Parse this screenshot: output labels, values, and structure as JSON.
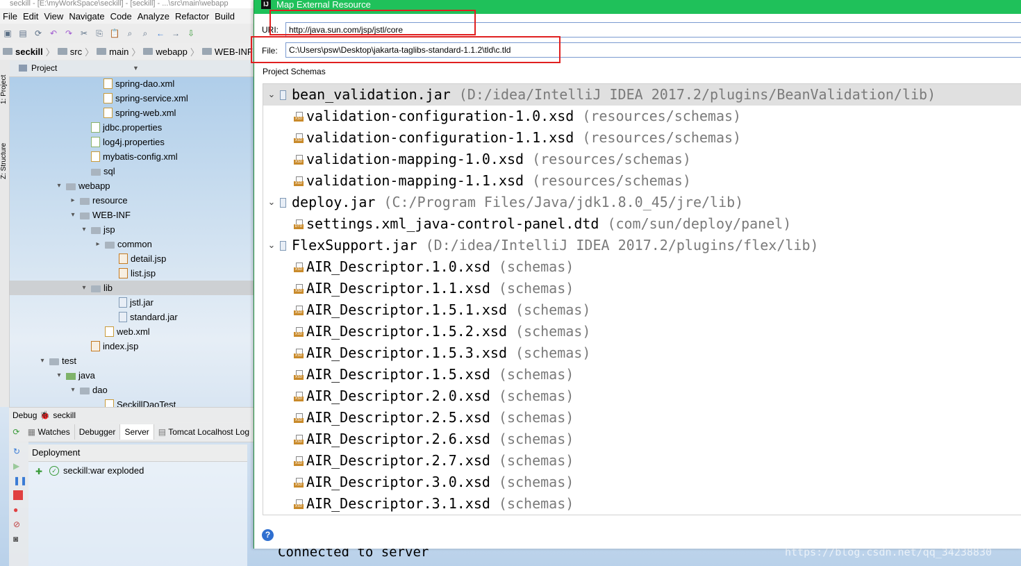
{
  "ide": {
    "titlebar": "seckill - [E:\\myWorkSpace\\seckill] - [seckill] - ...\\src\\main\\webapp",
    "menu": [
      "File",
      "Edit",
      "View",
      "Navigate",
      "Code",
      "Analyze",
      "Refactor",
      "Build"
    ],
    "breadcrumb": [
      "seckill",
      "src",
      "main",
      "webapp",
      "WEB-INF"
    ],
    "left_stripe": [
      "1: Project",
      "Z: Structure"
    ],
    "project_panel_title": "Project",
    "tree": [
      {
        "label": "spring-dao.xml",
        "icon": "xml-file-icon"
      },
      {
        "label": "spring-service.xml",
        "icon": "xml-file-icon"
      },
      {
        "label": "spring-web.xml",
        "icon": "xml-file-icon"
      },
      {
        "label": "jdbc.properties",
        "icon": "properties-file-icon"
      },
      {
        "label": "log4j.properties",
        "icon": "properties-file-icon"
      },
      {
        "label": "mybatis-config.xml",
        "icon": "xml-file-icon"
      },
      {
        "label": "sql",
        "icon": "folder-icon"
      },
      {
        "label": "webapp",
        "icon": "folder-icon",
        "arrow": "▾"
      },
      {
        "label": "resource",
        "icon": "folder-icon",
        "arrow": "▸"
      },
      {
        "label": "WEB-INF",
        "icon": "folder-icon",
        "arrow": "▾"
      },
      {
        "label": "jsp",
        "icon": "folder-icon",
        "arrow": "▾"
      },
      {
        "label": "common",
        "icon": "folder-icon",
        "arrow": "▸"
      },
      {
        "label": "detail.jsp",
        "icon": "jsp-file-icon"
      },
      {
        "label": "list.jsp",
        "icon": "jsp-file-icon"
      },
      {
        "label": "lib",
        "icon": "folder-icon",
        "arrow": "▾"
      },
      {
        "label": "jstl.jar",
        "icon": "jar-file-icon"
      },
      {
        "label": "standard.jar",
        "icon": "jar-file-icon"
      },
      {
        "label": "web.xml",
        "icon": "xml-file-icon"
      },
      {
        "label": "index.jsp",
        "icon": "jsp-file-icon"
      },
      {
        "label": "test",
        "icon": "folder-icon",
        "arrow": "▾"
      },
      {
        "label": "java",
        "icon": "java-folder-icon",
        "arrow": "▾"
      },
      {
        "label": "dao",
        "icon": "folder-icon",
        "arrow": "▾"
      },
      {
        "label": "SeckillDaoTest",
        "icon": "class-icon"
      }
    ],
    "debug_label": "Debug",
    "debug_config": "seckill",
    "debug_tabs": [
      "Watches",
      "Debugger",
      "Server",
      "Tomcat Localhost Log"
    ],
    "debug_active_tab": "Server",
    "deployment_header": "Deployment",
    "deployment_item": "seckill:war exploded",
    "console_text": "Connected to server",
    "watermark": "https://blog.csdn.net/qq_34238830"
  },
  "dialog": {
    "title": "Map External Resource",
    "uri_label": "URI:",
    "uri_value": "http://java.sun.com/jsp/jstl/core",
    "file_label": "File:",
    "file_value": "C:\\Users\\psw\\Desktop\\jakarta-taglibs-standard-1.1.2\\tld\\c.tld",
    "schemas_label": "Project Schemas",
    "help_symbol": "?",
    "schemas": [
      {
        "kind": "jar",
        "name": "bean_validation.jar",
        "path": "(D:/idea/IntelliJ IDEA 2017.2/plugins/BeanValidation/lib)",
        "selected": true
      },
      {
        "kind": "xsd",
        "name": "validation-configuration-1.0.xsd",
        "path": "(resources/schemas)"
      },
      {
        "kind": "xsd",
        "name": "validation-configuration-1.1.xsd",
        "path": "(resources/schemas)"
      },
      {
        "kind": "xsd",
        "name": "validation-mapping-1.0.xsd",
        "path": "(resources/schemas)"
      },
      {
        "kind": "xsd",
        "name": "validation-mapping-1.1.xsd",
        "path": "(resources/schemas)"
      },
      {
        "kind": "jar",
        "name": "deploy.jar",
        "path": "(C:/Program Files/Java/jdk1.8.0_45/jre/lib)"
      },
      {
        "kind": "dtd",
        "name": "settings.xml_java-control-panel.dtd",
        "path": "(com/sun/deploy/panel)"
      },
      {
        "kind": "jar",
        "name": "FlexSupport.jar",
        "path": "(D:/idea/IntelliJ IDEA 2017.2/plugins/flex/lib)"
      },
      {
        "kind": "xsd",
        "name": "AIR_Descriptor.1.0.xsd",
        "path": "(schemas)"
      },
      {
        "kind": "xsd",
        "name": "AIR_Descriptor.1.1.xsd",
        "path": "(schemas)"
      },
      {
        "kind": "xsd",
        "name": "AIR_Descriptor.1.5.1.xsd",
        "path": "(schemas)"
      },
      {
        "kind": "xsd",
        "name": "AIR_Descriptor.1.5.2.xsd",
        "path": "(schemas)"
      },
      {
        "kind": "xsd",
        "name": "AIR_Descriptor.1.5.3.xsd",
        "path": "(schemas)"
      },
      {
        "kind": "xsd",
        "name": "AIR_Descriptor.1.5.xsd",
        "path": "(schemas)"
      },
      {
        "kind": "xsd",
        "name": "AIR_Descriptor.2.0.xsd",
        "path": "(schemas)"
      },
      {
        "kind": "xsd",
        "name": "AIR_Descriptor.2.5.xsd",
        "path": "(schemas)"
      },
      {
        "kind": "xsd",
        "name": "AIR_Descriptor.2.6.xsd",
        "path": "(schemas)"
      },
      {
        "kind": "xsd",
        "name": "AIR_Descriptor.2.7.xsd",
        "path": "(schemas)"
      },
      {
        "kind": "xsd",
        "name": "AIR_Descriptor.3.0.xsd",
        "path": "(schemas)"
      },
      {
        "kind": "xsd",
        "name": "AIR_Descriptor.3.1.xsd",
        "path": "(schemas)"
      }
    ]
  },
  "colors": {
    "dialog_title_bg": "#1fc15a",
    "highlight_box": "#e02020",
    "selection_bg": "#e0e0e0",
    "path_text": "#7a7a7a"
  }
}
